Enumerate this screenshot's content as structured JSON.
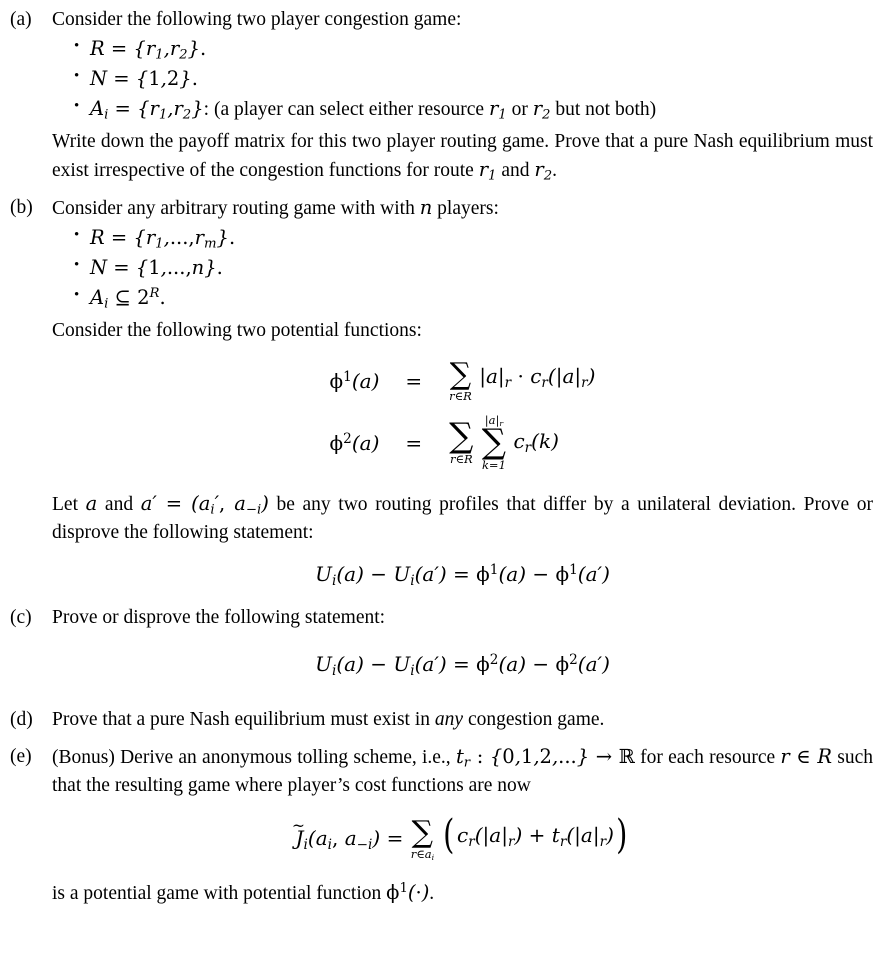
{
  "document": {
    "type": "problem-set",
    "background": "#ffffff",
    "text_color": "#000000"
  },
  "items": [
    {
      "label": "(a)",
      "intro": "Consider the following two player congestion game:",
      "bullets": [
        {
          "math": "R = {r1, r2}."
        },
        {
          "math": "N = {1, 2}."
        },
        {
          "math": "Ai = {r1, r2}: (a player can select either resource r1 or r2 but not both)"
        }
      ],
      "paragraph": "Write down the payoff matrix for this two player routing game. Prove that a pure Nash equilibrium must exist irrespective of the congestion functions for route r1 and r2."
    },
    {
      "label": "(b)",
      "intro": "Consider any arbitrary routing game with with n players:",
      "bullets": [
        {
          "math": "R = {r1, ..., rm}."
        },
        {
          "math": "N = {1, ..., n}."
        },
        {
          "math": "Ai ⊆ 2^R."
        }
      ],
      "intro2": "Consider the following two potential functions:",
      "paragraph": "Let a and a′ = (a′i, a−i) be any two routing profiles that differ by a unilateral deviation. Prove or disprove the following statement:"
    },
    {
      "label": "(c)",
      "intro": "Prove or disprove the following statement:"
    },
    {
      "label": "(d)",
      "intro": "Prove that a pure Nash equilibrium must exist in any congestion game."
    },
    {
      "label": "(e)",
      "intro": "(Bonus) Derive an anonymous tolling scheme, i.e., tr : {0, 1, 2, ...} → R for each resource r ∈ R such that the resulting game where player’s cost functions are now",
      "closing": "is a potential game with potential function ϕ¹(·)."
    }
  ],
  "text": {
    "a_intro": "Consider the following two player congestion game:",
    "a_para_1": "Write down the payoff matrix for this two player routing game. Prove that a pure Nash",
    "a_para_2": "equilibrium must exist irrespective of the congestion functions for route ",
    "a_para_2_end": ".",
    "b_intro_pre": "Consider any arbitrary routing game with with ",
    "b_intro_post": " players:",
    "b_potential_intro": "Consider the following two potential functions:",
    "b_let_pre": "Let ",
    "b_let_mid": " and ",
    "b_let_post": " be any two routing profiles that differ by a unilateral deviation.",
    "b_prove": "Prove or disprove the following statement:",
    "c_intro": "Prove or disprove the following statement:",
    "d_intro_pre": "Prove that a pure Nash equilibrium must exist in ",
    "d_emph": "any",
    "d_intro_post": " congestion game.",
    "e_bonus_pre": "(Bonus) Derive an anonymous tolling scheme, i.e., ",
    "e_bonus_mid": " for each resource",
    "e_bonus_line2_pre": " such that the resulting game where player’s cost functions are now",
    "e_closing_pre": "is a potential game with potential function ",
    "e_closing_post": "."
  },
  "labels": {
    "a": "(a)",
    "b": "(b)",
    "c": "(c)",
    "d": "(d)",
    "e": "(e)"
  },
  "symbols": {
    "bullet": "•",
    "phi": "ϕ",
    "sum": "∑",
    "in": "∈",
    "subset_eq": "⊆",
    "arrow_right": "→",
    "cdot": "·",
    "minus": "−",
    "equals": "=",
    "prime": "′",
    "tilde": "~",
    "blackboard_R": "ℝ",
    "cal_R": "R",
    "cal_A": "A"
  },
  "equations": {
    "phi1": {
      "lhs": "ϕ¹(a)",
      "rel": "=",
      "sum_limit": "r∈R",
      "body": "|a|r · cr(|a|r)"
    },
    "phi2": {
      "lhs": "ϕ²(a)",
      "rel": "=",
      "sum1_limit": "r∈R",
      "sum2_lower": "k=1",
      "sum2_upper": "|a|r",
      "body": "cr(k)"
    },
    "b_statement": "Ui(a) − Ui(a′) = ϕ¹(a) − ϕ¹(a′)",
    "c_statement": "Ui(a) − Ui(a′) = ϕ²(a) − ϕ²(a′)",
    "e_statement": {
      "lhs": "J̃i(ai, a−i)",
      "rel": "=",
      "sum_limit": "r∈ai",
      "body": "( cr(|a|r) + tr(|a|r) )"
    }
  },
  "math_tokens": {
    "r1": "r1",
    "r2": "r2",
    "rm": "rm",
    "n": "n",
    "m": "m",
    "set_R_two": "{r1, r2}",
    "set_N_two": "{1, 2}",
    "set_R_m": "{r1, ..., rm}",
    "set_N_n": "{1, ..., n}",
    "power_set": "2^R",
    "toll_domain": "{0, 1, 2, ...}"
  }
}
